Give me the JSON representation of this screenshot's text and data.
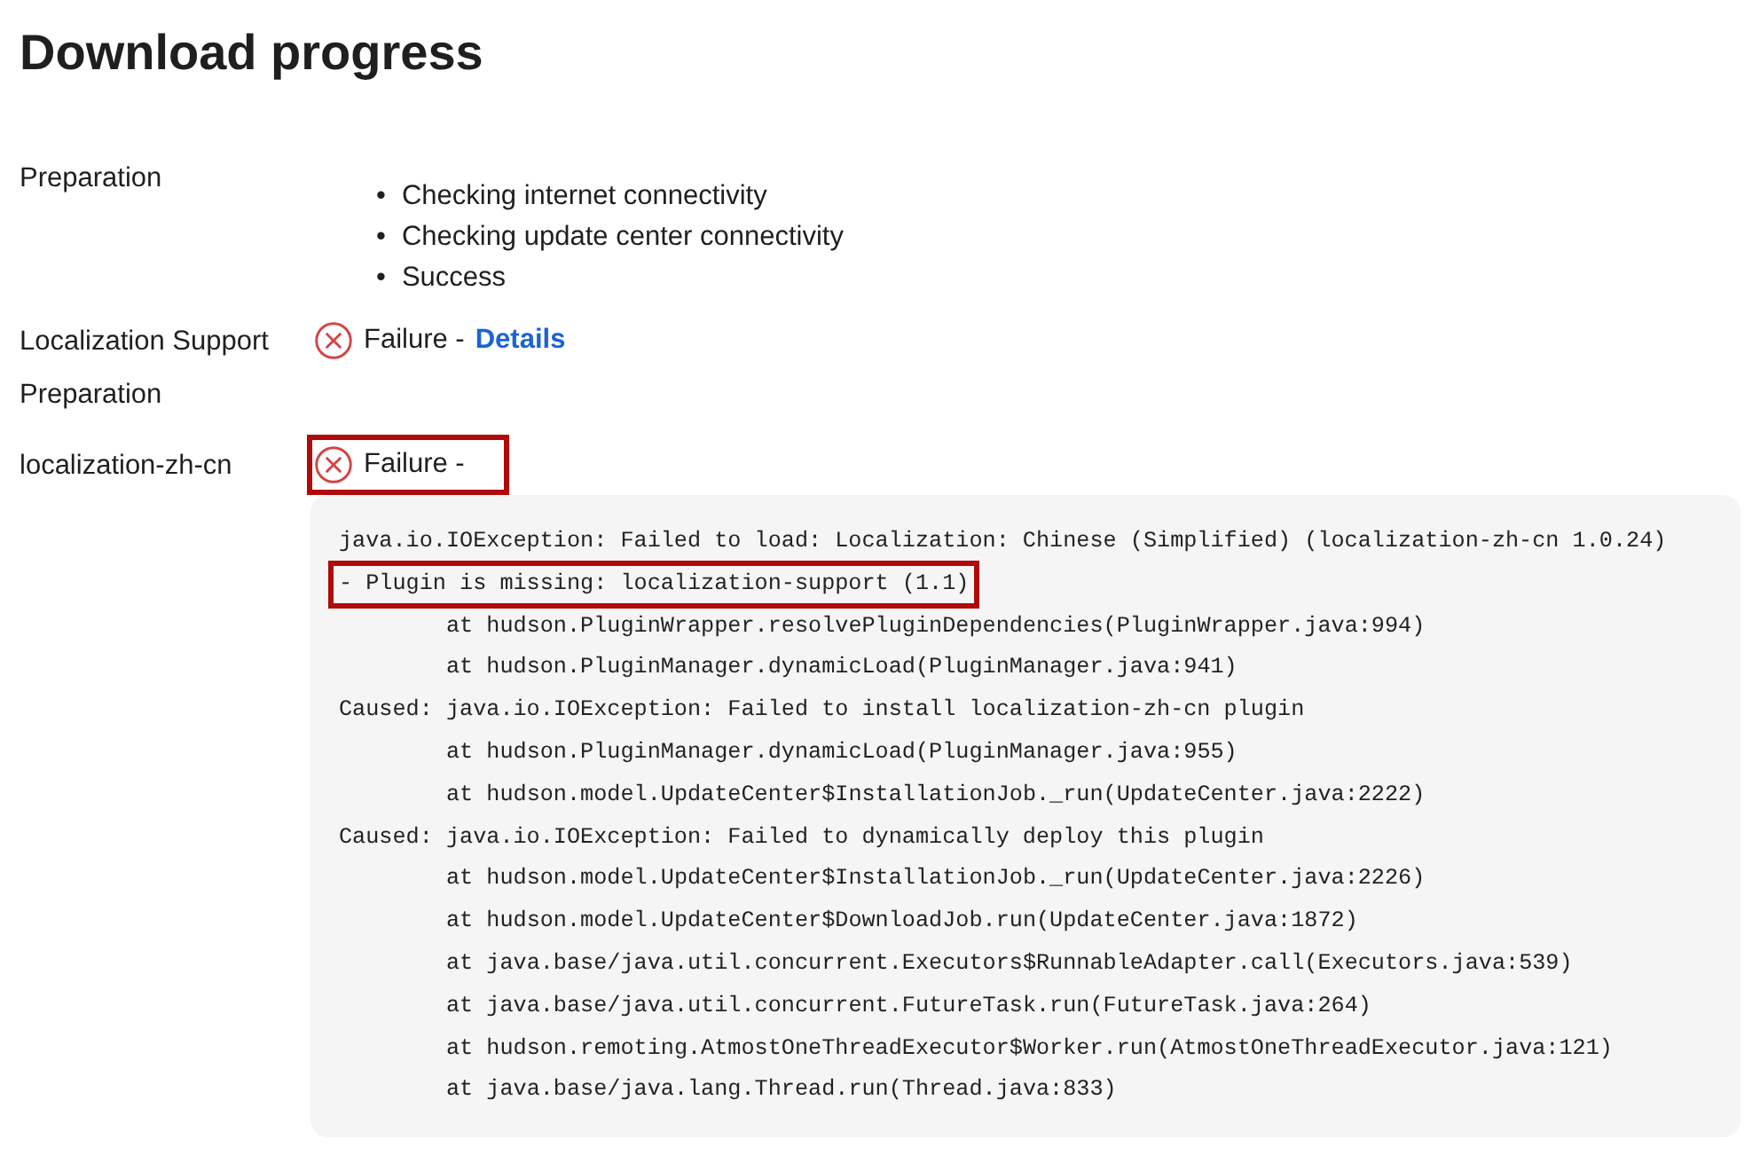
{
  "title": "Download progress",
  "rows": [
    {
      "kind": "steps",
      "label": "Preparation",
      "bullet": "•",
      "steps": [
        "Checking internet connectivity",
        "Checking update center connectivity",
        "Success"
      ]
    },
    {
      "kind": "status",
      "label": "Localization Support Preparation",
      "text": "Failure -",
      "link": "Details",
      "highlighted": false
    },
    {
      "kind": "status",
      "label": "localization-zh-cn",
      "text": "Failure -",
      "highlighted": true,
      "trace": [
        {
          "text": "java.io.IOException: Failed to load: Localization: Chinese (Simplified) (localization-zh-cn 1.0.24)",
          "highlighted": false
        },
        {
          "text": "- Plugin is missing: localization-support (1.1)",
          "highlighted": true
        },
        {
          "text": "\tat hudson.PluginWrapper.resolvePluginDependencies(PluginWrapper.java:994)",
          "highlighted": false
        },
        {
          "text": "\tat hudson.PluginManager.dynamicLoad(PluginManager.java:941)",
          "highlighted": false
        },
        {
          "text": "Caused: java.io.IOException: Failed to install localization-zh-cn plugin",
          "highlighted": false
        },
        {
          "text": "\tat hudson.PluginManager.dynamicLoad(PluginManager.java:955)",
          "highlighted": false
        },
        {
          "text": "\tat hudson.model.UpdateCenter$InstallationJob._run(UpdateCenter.java:2222)",
          "highlighted": false
        },
        {
          "text": "Caused: java.io.IOException: Failed to dynamically deploy this plugin",
          "highlighted": false
        },
        {
          "text": "\tat hudson.model.UpdateCenter$InstallationJob._run(UpdateCenter.java:2226)",
          "highlighted": false
        },
        {
          "text": "\tat hudson.model.UpdateCenter$DownloadJob.run(UpdateCenter.java:1872)",
          "highlighted": false
        },
        {
          "text": "\tat java.base/java.util.concurrent.Executors$RunnableAdapter.call(Executors.java:539)",
          "highlighted": false
        },
        {
          "text": "\tat java.base/java.util.concurrent.FutureTask.run(FutureTask.java:264)",
          "highlighted": false
        },
        {
          "text": "\tat hudson.remoting.AtmostOneThreadExecutor$Worker.run(AtmostOneThreadExecutor.java:121)",
          "highlighted": false
        },
        {
          "text": "\tat java.base/java.lang.Thread.run(Thread.java:833)",
          "highlighted": false
        }
      ]
    }
  ]
}
